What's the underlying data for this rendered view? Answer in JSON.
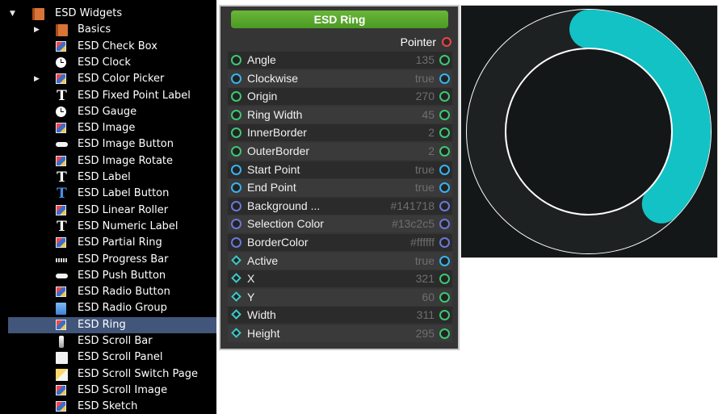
{
  "tree": {
    "items": [
      {
        "label": "ESD Widgets",
        "icon": "book-icon",
        "arrow": "expanded",
        "indent": 1
      },
      {
        "label": "Basics",
        "icon": "book-icon",
        "arrow": "collapsed",
        "indent": 2
      },
      {
        "label": "ESD Check Box",
        "icon": "picture-icon",
        "indent": 2
      },
      {
        "label": "ESD Clock",
        "icon": "clock-icon",
        "indent": 2
      },
      {
        "label": "ESD Color Picker",
        "icon": "picture-icon",
        "arrow": "collapsed",
        "indent": 2
      },
      {
        "label": "ESD Fixed Point Label",
        "icon": "text-icon",
        "indent": 2
      },
      {
        "label": "ESD Gauge",
        "icon": "clock-icon",
        "indent": 2
      },
      {
        "label": "ESD Image",
        "icon": "picture-icon",
        "indent": 2
      },
      {
        "label": "ESD Image Button",
        "icon": "button-icon",
        "indent": 2
      },
      {
        "label": "ESD Image Rotate",
        "icon": "picture-icon",
        "indent": 2
      },
      {
        "label": "ESD Label",
        "icon": "text-icon",
        "indent": 2
      },
      {
        "label": "ESD Label Button",
        "icon": "text-blue-icon",
        "indent": 2
      },
      {
        "label": "ESD Linear Roller",
        "icon": "picture-icon",
        "indent": 2
      },
      {
        "label": "ESD Numeric Label",
        "icon": "text-icon",
        "indent": 2
      },
      {
        "label": "ESD Partial Ring",
        "icon": "picture-icon",
        "indent": 2
      },
      {
        "label": "ESD Progress Bar",
        "icon": "progress-icon",
        "indent": 2
      },
      {
        "label": "ESD Push Button",
        "icon": "button-icon",
        "indent": 2
      },
      {
        "label": "ESD Radio Button",
        "icon": "picture-icon",
        "indent": 2
      },
      {
        "label": "ESD Radio Group",
        "icon": "group-icon",
        "indent": 2
      },
      {
        "label": "ESD Ring",
        "icon": "picture-icon",
        "indent": 2,
        "selected": true
      },
      {
        "label": "ESD Scroll Bar",
        "icon": "scrollbar-icon",
        "indent": 2
      },
      {
        "label": "ESD Scroll Panel",
        "icon": "panel-icon",
        "indent": 2
      },
      {
        "label": "ESD Scroll Switch Page",
        "icon": "switch-page-icon",
        "indent": 2
      },
      {
        "label": "ESD Scroll Image",
        "icon": "picture-icon",
        "indent": 2
      },
      {
        "label": "ESD Sketch",
        "icon": "picture-icon",
        "indent": 2
      }
    ]
  },
  "node": {
    "title": "ESD Ring",
    "pointer_label": "Pointer",
    "properties": [
      {
        "label": "Angle",
        "value": "135",
        "pin": "green"
      },
      {
        "label": "Clockwise",
        "value": "true",
        "pin": "blue"
      },
      {
        "label": "Origin",
        "value": "270",
        "pin": "green"
      },
      {
        "label": "Ring Width",
        "value": "45",
        "pin": "green"
      },
      {
        "label": "InnerBorder",
        "value": "2",
        "pin": "green"
      },
      {
        "label": "OuterBorder",
        "value": "2",
        "pin": "green"
      },
      {
        "label": "Start Point",
        "value": "true",
        "pin": "blue"
      },
      {
        "label": "End Point",
        "value": "true",
        "pin": "blue"
      },
      {
        "label": "Background ...",
        "value": "#141718",
        "pin": "navy"
      },
      {
        "label": "Selection Color",
        "value": "#13c2c5",
        "pin": "navy"
      },
      {
        "label": "BorderColor",
        "value": "#ffffff",
        "pin": "navy"
      },
      {
        "label": "Active",
        "value": "true",
        "pin": "diamond-blue"
      },
      {
        "label": "X",
        "value": "321",
        "pin": "diamond-green"
      },
      {
        "label": "Y",
        "value": "60",
        "pin": "diamond-green"
      },
      {
        "label": "Width",
        "value": "311",
        "pin": "diamond-green"
      },
      {
        "label": "Height",
        "value": "295",
        "pin": "diamond-green"
      }
    ]
  },
  "preview": {
    "background": "#141718",
    "selection_color": "#13c2c5",
    "border_color": "#ffffff",
    "ring_color": "#1e2122",
    "angle_deg": 135,
    "origin_deg": 270,
    "clockwise": true
  }
}
